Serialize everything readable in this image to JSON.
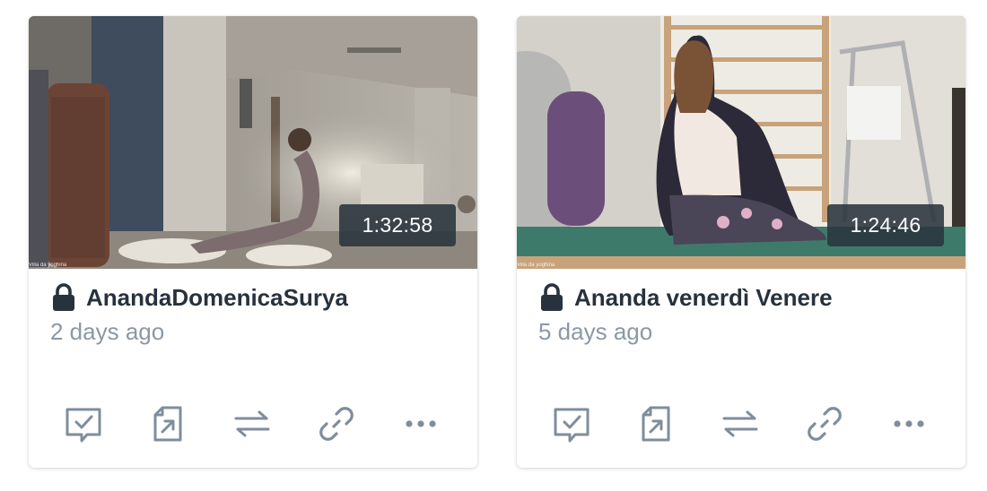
{
  "cards": [
    {
      "title": "AnandaDomenicaSurya",
      "age": "2 days ago",
      "duration": "1:32:58",
      "watermark": "Villa da yoghina",
      "locked": true
    },
    {
      "title": "Ananda venerdì Venere",
      "age": "5 days ago",
      "duration": "1:24:46",
      "watermark": "Villa da yoghina",
      "locked": true
    }
  ],
  "icons": {
    "lock": "lock-icon",
    "actions": [
      "review-icon",
      "share-icon",
      "transfer-icon",
      "link-icon",
      "more-icon"
    ]
  },
  "colors": {
    "title": "#27323d",
    "subtitle": "#8b98a6",
    "icon": "#7f8d9c",
    "duration_bg": "#2a343e"
  }
}
